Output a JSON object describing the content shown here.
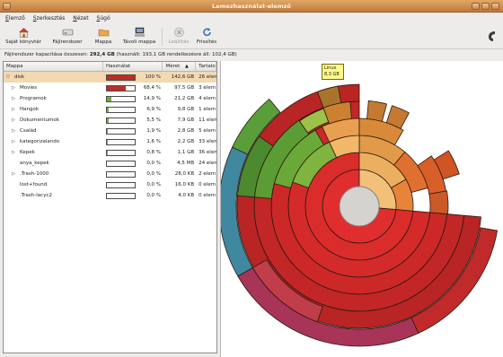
{
  "window": {
    "title": "Lemezhasználat-elemző"
  },
  "menu": [
    "Elemző",
    "Szerkesztés",
    "Nézet",
    "Súgó"
  ],
  "toolbar": [
    {
      "label": "Saját könyvtár",
      "icon": "home-icon",
      "enabled": true
    },
    {
      "label": "Fájlrendszer",
      "icon": "harddisk-icon",
      "enabled": true
    },
    {
      "label": "Mappa",
      "icon": "folder-icon",
      "enabled": true
    },
    {
      "label": "Távoli mappa",
      "icon": "network-folder-icon",
      "enabled": true
    },
    {
      "label": "Leállítás",
      "icon": "stop-icon",
      "enabled": false
    },
    {
      "label": "Frissítés",
      "icon": "refresh-icon",
      "enabled": true
    }
  ],
  "info": {
    "prefix": "Fájlrendszer kapacitása összesen:",
    "total": "292,4 GB",
    "rest": "(használt: 193,1 GB rendelkezésre áll: 102,4 GB)"
  },
  "columns": [
    "Mappa",
    "Használat",
    "Méret",
    "Tartalom"
  ],
  "sort_indicator": "▲",
  "rows": [
    {
      "name": "disk",
      "percent": "100 %",
      "usage": 1.0,
      "size": "142,6 GB",
      "items": "26 elem",
      "expander": "▽",
      "level": 0,
      "selected": true,
      "bar_color": "#c02a2a"
    },
    {
      "name": "Movies",
      "percent": "68,4 %",
      "usage": 0.684,
      "size": "97,5 GB",
      "items": "3 elem",
      "expander": "▷",
      "level": 1,
      "bar_color": "#c02a2a"
    },
    {
      "name": "Programok",
      "percent": "14,9 %",
      "usage": 0.149,
      "size": "21,2 GB",
      "items": "4 elem",
      "expander": "▷",
      "level": 1,
      "bar_color": "#6fae3c"
    },
    {
      "name": "Hangok",
      "percent": "6,9 %",
      "usage": 0.069,
      "size": "9,8 GB",
      "items": "1 elem",
      "expander": "▷",
      "level": 1,
      "bar_color": "#6fae3c"
    },
    {
      "name": "Dokumentumok",
      "percent": "5,5 %",
      "usage": 0.055,
      "size": "7,9 GB",
      "items": "11 elem",
      "expander": "▷",
      "level": 1,
      "bar_color": "#6fae3c"
    },
    {
      "name": "Család",
      "percent": "1,9 %",
      "usage": 0.019,
      "size": "2,8 GB",
      "items": "5 elem",
      "expander": "▷",
      "level": 1,
      "bar_color": "#6fae3c"
    },
    {
      "name": "kategorizalando",
      "percent": "1,6 %",
      "usage": 0.016,
      "size": "2,2 GB",
      "items": "33 elem",
      "expander": "▷",
      "level": 1,
      "bar_color": "#6fae3c"
    },
    {
      "name": "Kepek",
      "percent": "0,8 %",
      "usage": 0.008,
      "size": "1,1 GB",
      "items": "36 elem",
      "expander": "▷",
      "level": 1,
      "bar_color": "#6fae3c"
    },
    {
      "name": "anya_kepek",
      "percent": "0,0 %",
      "usage": 0.0,
      "size": "4,5 MB",
      "items": "24 elem",
      "expander": "",
      "level": 1,
      "bar_color": "#6fae3c"
    },
    {
      "name": ".Trash-1000",
      "percent": "0,0 %",
      "usage": 0.0,
      "size": "28,0 KB",
      "items": "2 elem",
      "expander": "▷",
      "level": 1,
      "bar_color": "#6fae3c"
    },
    {
      "name": "lost+found",
      "percent": "0,0 %",
      "usage": 0.0,
      "size": "16,0 KB",
      "items": "0 elem",
      "expander": "",
      "level": 1,
      "bar_color": "#6fae3c"
    },
    {
      "name": ".Trash-lacyc2",
      "percent": "0,0 %",
      "usage": 0.0,
      "size": "4,0 KB",
      "items": "0 elem",
      "expander": "",
      "level": 1,
      "bar_color": "#6fae3c"
    }
  ],
  "tooltip": {
    "name": "Linux",
    "size": "8,3 GB"
  }
}
